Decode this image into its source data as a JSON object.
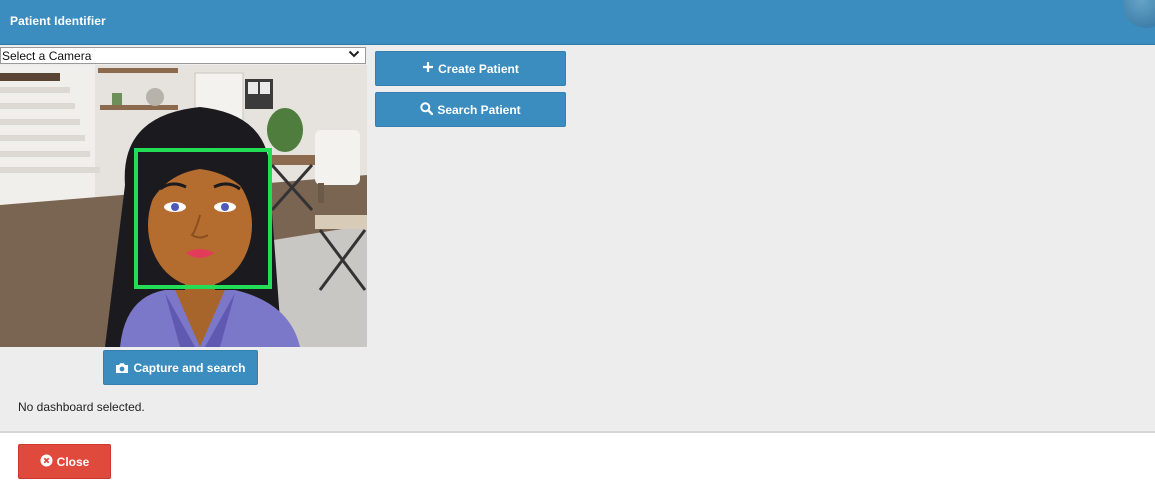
{
  "window": {
    "title": "Patient Identifier"
  },
  "camera": {
    "selected": "Select a Camera"
  },
  "buttons": {
    "create_patient": "Create Patient",
    "search_patient": "Search Patient",
    "capture_and_search": "Capture and search",
    "close": "Close"
  },
  "status": {
    "message": "No dashboard selected."
  },
  "colors": {
    "header": "#3b8dc0",
    "primary_button": "#3b8dc0",
    "danger_button": "#e04a3c",
    "face_box": "#22dd55",
    "panel_bg": "#ededed"
  },
  "icons": {
    "create": "plus-icon",
    "search": "search-icon",
    "capture": "camera-icon",
    "close": "close-circle-icon",
    "select": "chevron-down-icon"
  }
}
